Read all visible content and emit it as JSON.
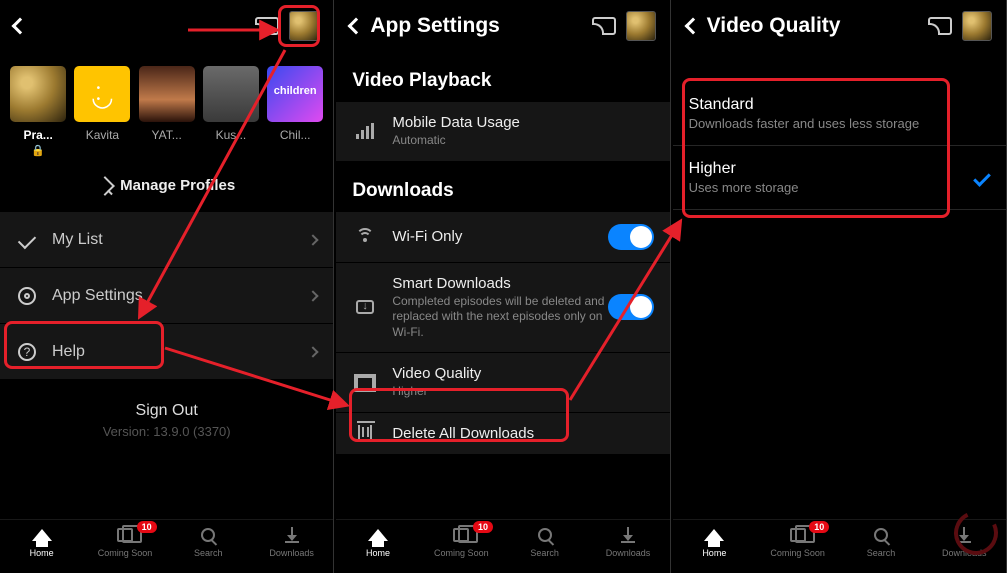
{
  "screen1": {
    "profiles": [
      {
        "label": "Pra...",
        "tile": "leopard",
        "active": true
      },
      {
        "label": "Kavita",
        "tile": "yellow"
      },
      {
        "label": "YAT...",
        "tile": "man"
      },
      {
        "label": "Kus...",
        "tile": "grey"
      },
      {
        "label": "Chil...",
        "tile": "children",
        "tiletext": "children"
      }
    ],
    "manage": "Manage Profiles",
    "menu": {
      "mylist": "My List",
      "appsettings": "App Settings",
      "help": "Help"
    },
    "signout": "Sign Out",
    "version": "Version: 13.9.0 (3370)"
  },
  "screen2": {
    "title": "App Settings",
    "section_playback": "Video Playback",
    "mobile_data": {
      "title": "Mobile Data Usage",
      "sub": "Automatic"
    },
    "section_downloads": "Downloads",
    "wifi_only": "Wi-Fi Only",
    "smart": {
      "title": "Smart Downloads",
      "sub": "Completed episodes will be deleted and replaced with the next episodes only on Wi-Fi."
    },
    "vq": {
      "title": "Video Quality",
      "sub": "Higher"
    },
    "delete": "Delete All Downloads"
  },
  "screen3": {
    "title": "Video Quality",
    "standard": {
      "title": "Standard",
      "sub": "Downloads faster and uses less storage"
    },
    "higher": {
      "title": "Higher",
      "sub": "Uses more storage"
    }
  },
  "bottomnav": {
    "home": "Home",
    "coming": "Coming Soon",
    "search": "Search",
    "downloads": "Downloads",
    "badge": "10"
  }
}
